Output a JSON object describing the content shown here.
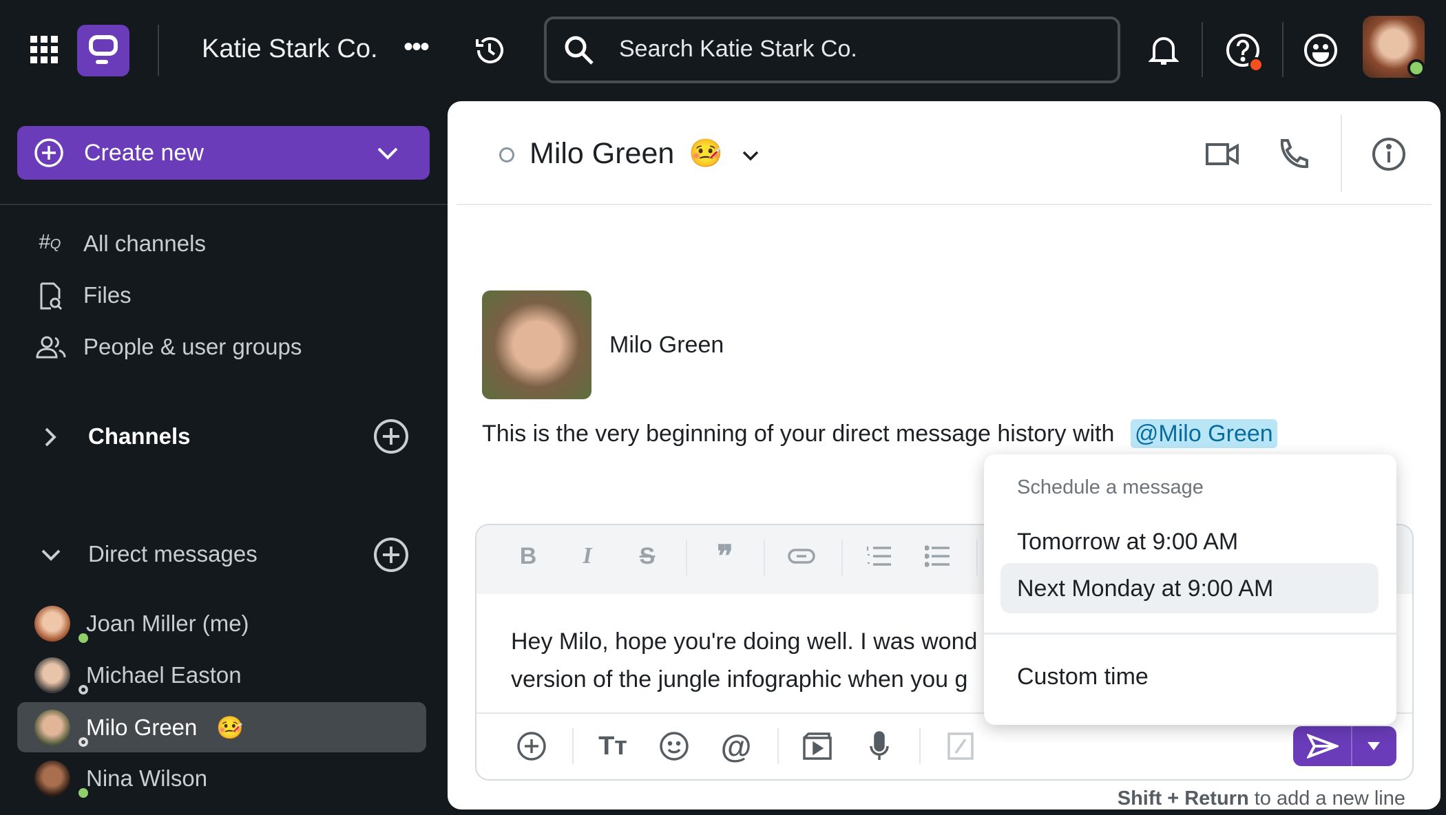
{
  "topbar": {
    "workspace": "Katie Stark Co.",
    "search_placeholder": "Search Katie Stark Co.",
    "brand_color": "#6a3cb9"
  },
  "sidebar": {
    "create_new": "Create new",
    "nav": [
      {
        "label": "All channels",
        "icon": "hashtag-search-icon"
      },
      {
        "label": "Files",
        "icon": "file-search-icon"
      },
      {
        "label": "People & user groups",
        "icon": "people-icon"
      }
    ],
    "channels_label": "Channels",
    "dm_label": "Direct messages",
    "dms": [
      {
        "name": "Joan Miller (me)",
        "status": "online"
      },
      {
        "name": "Michael Easton",
        "status": "offline"
      },
      {
        "name": "Milo Green",
        "emoji": "🤒",
        "status": "offline",
        "selected": true
      },
      {
        "name": "Nina Wilson",
        "status": "online"
      }
    ]
  },
  "conversation": {
    "name": "Milo Green",
    "emoji": "🤒",
    "profile_name": "Milo Green",
    "intro": "This is the very beginning of your direct message history with",
    "mention": "@Milo Green",
    "draft_line1": "Hey Milo, hope you're doing well. I was wond",
    "draft_line2": "version of the jungle infographic when you g",
    "hint_bold": "Shift + Return",
    "hint_rest": " to add a new line"
  },
  "schedule_menu": {
    "title": "Schedule a message",
    "options": [
      "Tomorrow at 9:00 AM",
      "Next Monday at 9:00 AM",
      "Custom time"
    ],
    "highlighted": "Next Monday at 9:00 AM"
  }
}
